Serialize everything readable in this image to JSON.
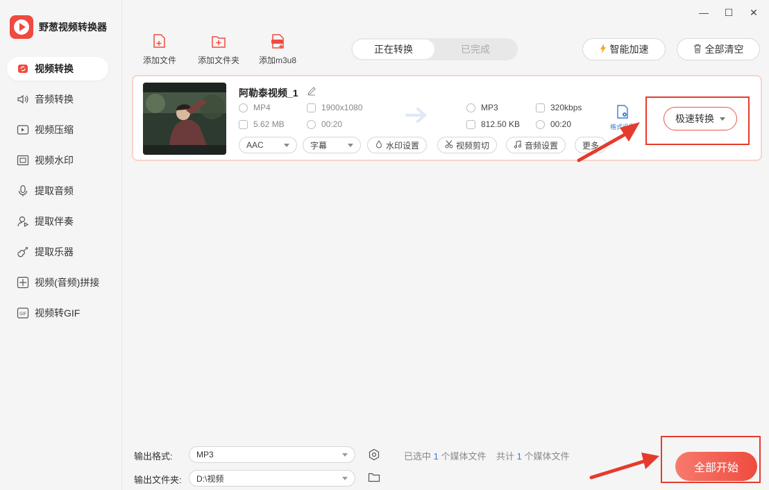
{
  "app": {
    "name": "野葱视频转换器"
  },
  "window_controls": {
    "minimize": "—",
    "maximize": "☐",
    "close": "✕"
  },
  "sidebar": {
    "items": [
      {
        "label": "视频转换",
        "icon": "convert-icon",
        "active": true
      },
      {
        "label": "音频转换",
        "icon": "speaker-icon"
      },
      {
        "label": "视频压缩",
        "icon": "compress-icon"
      },
      {
        "label": "视频水印",
        "icon": "watermark-icon"
      },
      {
        "label": "提取音频",
        "icon": "microphone-icon"
      },
      {
        "label": "提取伴奏",
        "icon": "accompaniment-icon"
      },
      {
        "label": "提取乐器",
        "icon": "guitar-icon"
      },
      {
        "label": "视频(音频)拼接",
        "icon": "merge-icon"
      },
      {
        "label": "视频转GIF",
        "icon": "gif-icon"
      }
    ]
  },
  "toolbar": {
    "add_file": "添加文件",
    "add_folder": "添加文件夹",
    "add_m3u8": "添加m3u8",
    "m3u8_badge": "M3U8",
    "tabs": {
      "converting": "正在转换",
      "done": "已完成"
    },
    "smart_accel": "智能加速",
    "clear_all": "全部清空"
  },
  "file": {
    "name": "阿勒泰视频_1",
    "src_format": "MP4",
    "src_resolution": "1900x1080",
    "src_size": "5.62 MB",
    "src_duration": "00:20",
    "dst_format": "MP3",
    "dst_bitrate": "320kbps",
    "dst_size": "812.50 KB",
    "dst_duration": "00:20",
    "audio_codec": "AAC",
    "subtitle": "字幕",
    "watermark": "水印设置",
    "cut": "视频剪切",
    "audio_settings": "音频设置",
    "more": "更多",
    "format_settings": "格式设置",
    "fast_convert": "极速转换"
  },
  "bottom": {
    "output_format_label": "输出格式:",
    "output_format_value": "MP3",
    "output_folder_label": "输出文件夹:",
    "output_folder_value": "D:\\视频",
    "selected_prefix": "已选中",
    "selected_count": "1",
    "selected_suffix": "个媒体文件",
    "total_prefix": "共计",
    "total_count": "1",
    "total_suffix": "个媒体文件",
    "start_all": "全部开始"
  },
  "colors": {
    "accent": "#ef4b3f",
    "link": "#3a7bd5",
    "annotation": "#e53b2c"
  }
}
